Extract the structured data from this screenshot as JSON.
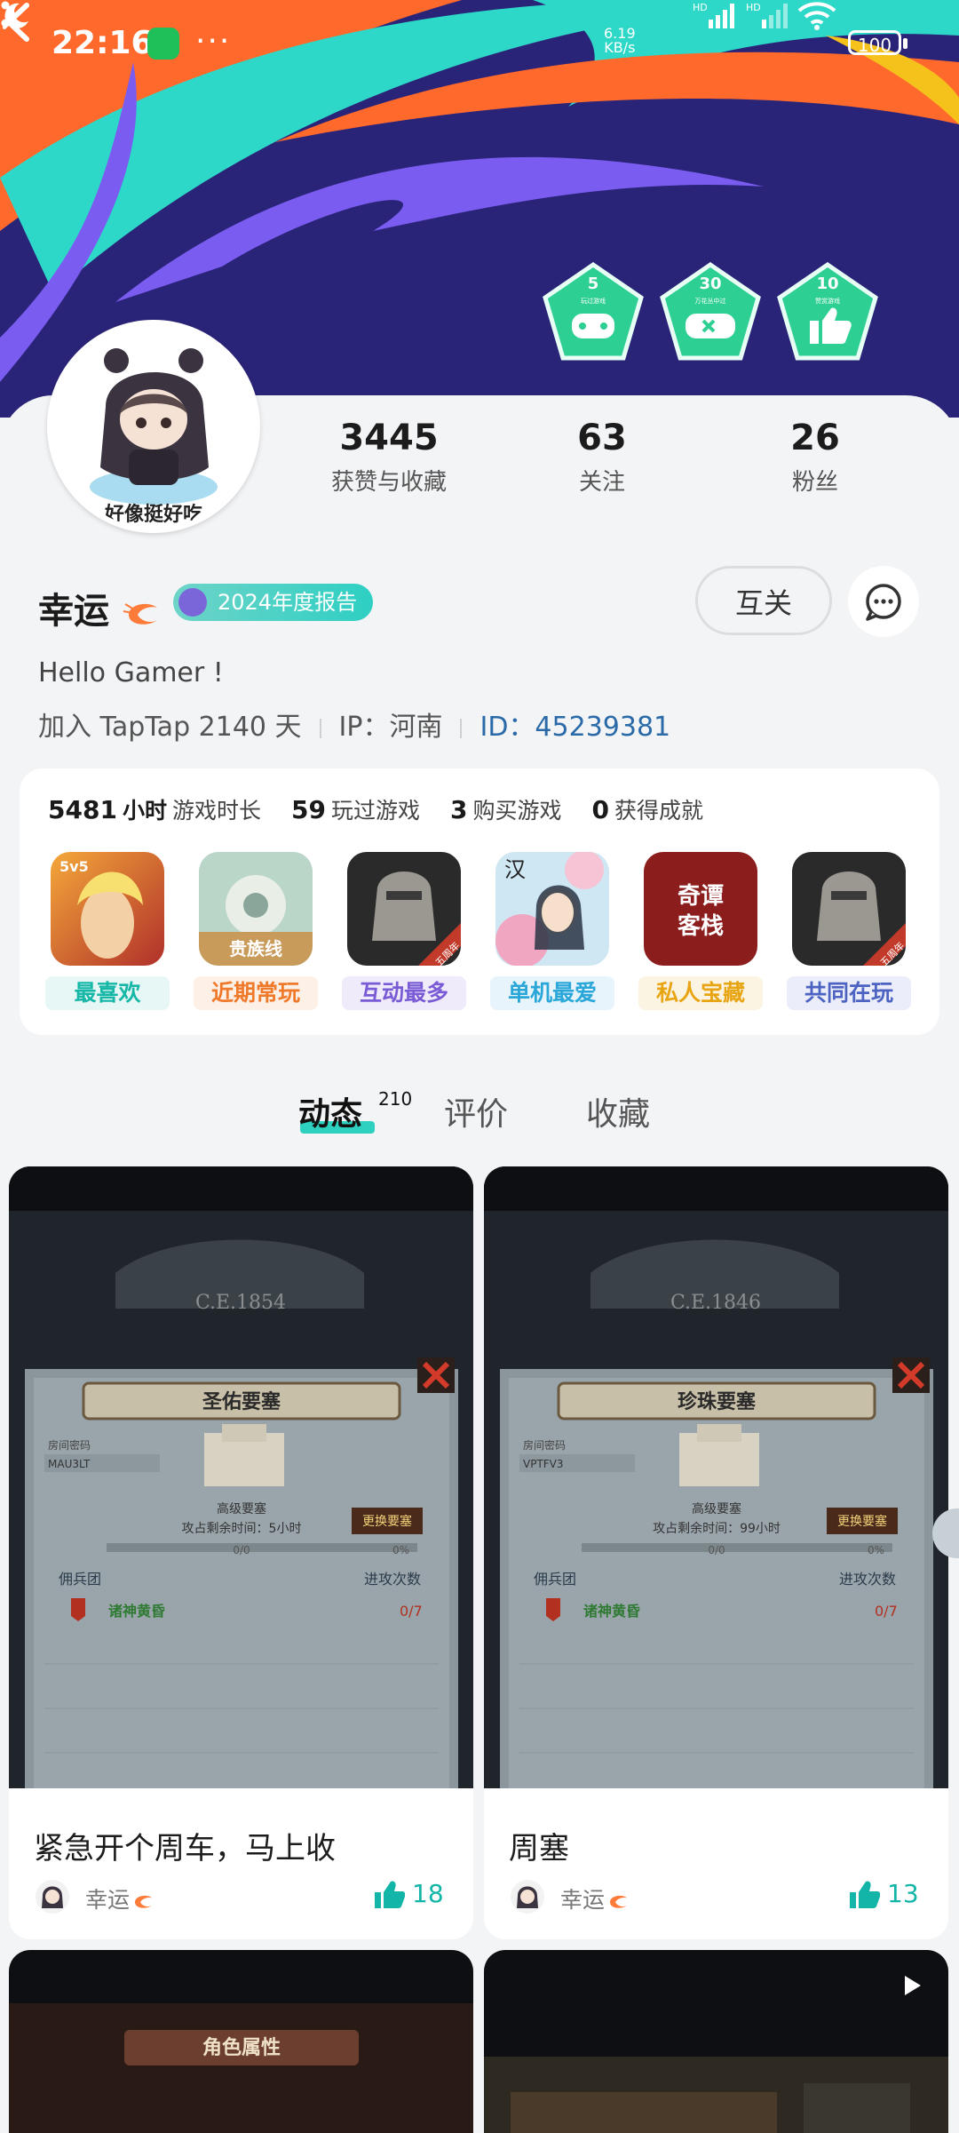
{
  "status_bar": {
    "time": "22:16",
    "more": "···",
    "net_speed_value": "6.19",
    "net_speed_unit": "KB/s",
    "signal1": "HD",
    "signal2": "HD",
    "battery": "100"
  },
  "badges": [
    {
      "count": "5",
      "caption": "玩过游戏"
    },
    {
      "count": "30",
      "caption": "万花丛中过"
    },
    {
      "count": "10",
      "caption": "赞赏游戏"
    }
  ],
  "profile": {
    "avatar_caption": "好像挺好吃",
    "stats": [
      {
        "value": "3445",
        "label": "获赞与收藏"
      },
      {
        "value": "63",
        "label": "关注"
      },
      {
        "value": "26",
        "label": "粉丝"
      }
    ],
    "name": "幸运",
    "report_badge": "2024年度报告",
    "mutual_label": "互关",
    "bio": "Hello Gamer !",
    "join": "加入 TapTap 2140 天",
    "ip": "IP：河南",
    "user_id": "ID：45239381"
  },
  "game_stats": {
    "hours": {
      "value": "5481",
      "unit": "小时",
      "label": "游戏时长"
    },
    "played": {
      "value": "59",
      "label": "玩过游戏"
    },
    "bought": {
      "value": "3",
      "label": "购买游戏"
    },
    "achievements": {
      "value": "0",
      "label": "获得成就"
    }
  },
  "game_tags": [
    {
      "label": "最喜欢",
      "color": "#17b7a8",
      "bg": "#e6f7f5",
      "icon_text": "5v5"
    },
    {
      "label": "近期常玩",
      "color": "#ef7a2c",
      "bg": "#fdf0e6",
      "icon_text": "贵族线"
    },
    {
      "label": "互动最多",
      "color": "#7a5bd6",
      "bg": "#efebfa",
      "icon_text": "五周年"
    },
    {
      "label": "单机最爱",
      "color": "#2aa7d8",
      "bg": "#e7f4fb",
      "icon_text": "汉"
    },
    {
      "label": "私人宝藏",
      "color": "#e8a513",
      "bg": "#fcf4e2",
      "icon_text": "奇谭客栈"
    },
    {
      "label": "共同在玩",
      "color": "#4d63c2",
      "bg": "#ebeefa",
      "icon_text": "五周年"
    }
  ],
  "tabs": [
    {
      "label": "动态",
      "count": "210"
    },
    {
      "label": "评价"
    },
    {
      "label": "收藏"
    }
  ],
  "posts": [
    {
      "title": "紧急开个周车，马上收",
      "author": "幸运",
      "likes": "18",
      "year": "C.E.1854",
      "fort": "圣佑要塞",
      "code": "MAU3LT",
      "remain": "攻占剩余时间：5小时"
    },
    {
      "title": "周塞",
      "author": "幸运",
      "likes": "13",
      "year": "C.E.1846",
      "fort": "珍珠要塞",
      "code": "VPTFV3",
      "remain": "攻占剩余时间：99小时"
    }
  ],
  "shot_labels": {
    "room_code": "房间密码",
    "level": "高级要塞",
    "change": "更换要塞",
    "progress": "0/0",
    "percent": "0%",
    "merc": "佣兵团",
    "attack": "进攻次数",
    "guild": "诸神黄昏",
    "attempts": "0/7",
    "role_attr": "角色属性"
  },
  "colors": {
    "accent": "#2ed0c0",
    "banner_bg": "#2a2479",
    "id_blue": "#2a6aa8"
  }
}
